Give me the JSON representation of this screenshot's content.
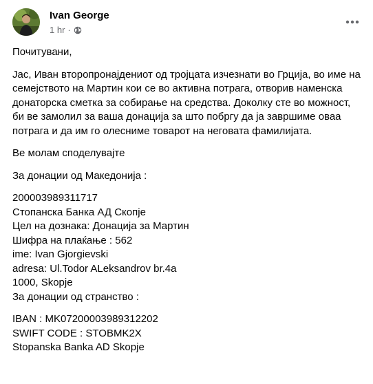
{
  "post": {
    "author": "Ivan George",
    "time": "1 hr",
    "separator": "·",
    "audience_icon": "globe-icon",
    "more_icon": "more-horizontal-icon"
  },
  "body": {
    "greeting": "Почитувани,",
    "intro": "Јас, Иван второпронајдениот од тројцата изчезнати во Грција, во име на семејството на Мартин кои се во активна потрага, отворив наменска донаторска сметка за собирање на средства. Доколку сте во можност, би ве замолил за ваша донација за што побргу да ја завршиме оваа потрага и да им го олесниме товарот на неговата фамилијата.",
    "share": "Ве молам споделувајте",
    "mk_heading": "За донации од Македонија :",
    "mk_lines": [
      "200003989311717",
      "Стопанска Банка АД Скопје",
      "Цел на дознака: Донација за Мартин",
      "Шифра на плаќање : 562",
      "ime: Ivan Gjorgievski",
      "adresa: Ul.Todor ALeksandrov  br.4a",
      "1000, Skopje",
      "За донации од странство :"
    ],
    "intl_lines": [
      "IBAN : MK07200003989312202",
      "SWIFT CODE : STOBMK2X",
      "Stopanska Banka AD Skopje"
    ]
  }
}
